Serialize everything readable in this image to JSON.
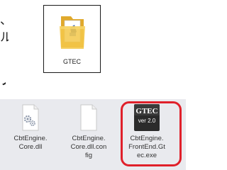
{
  "fragments": {
    "line1": "、",
    "line2": "ル",
    "line3": "ノ"
  },
  "folder": {
    "label": "GTEC",
    "icon": "folder-icon"
  },
  "files": [
    {
      "name": "CbtEngine.\nCore.dll",
      "icon": "dll-gear-icon"
    },
    {
      "name": "CbtEngine.\nCore.dll.con\nfig",
      "icon": "blank-file-icon"
    },
    {
      "name": "CbtEngine.\nFrontEnd.Gt\nec.exe",
      "icon": "gtec-app-icon"
    }
  ],
  "app_icon": {
    "title": "GTEC",
    "version": "ver 2.0"
  },
  "colors": {
    "highlight": "#e0202a",
    "folder_yellow": "#f3c84a",
    "explorer_bg": "#e9eaee"
  }
}
